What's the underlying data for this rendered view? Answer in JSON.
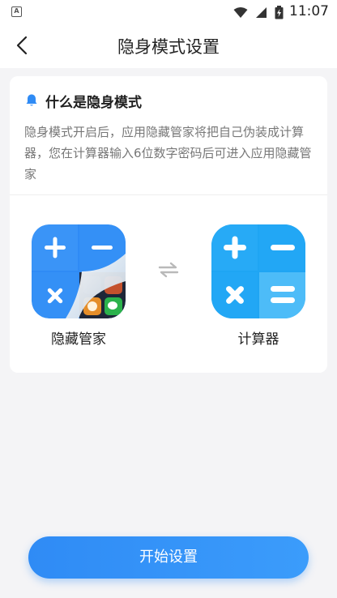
{
  "status_bar": {
    "app_badge": "A",
    "time": "11:07",
    "icons": [
      "wifi-icon",
      "signal-icon",
      "battery-charging-icon"
    ]
  },
  "nav": {
    "title": "隐身模式设置",
    "back_icon": "chevron-left-icon"
  },
  "info": {
    "title": "什么是隐身模式",
    "description": "隐身模式开启后，应用隐藏管家将把自己伪装成计算器，您在计算器输入6位数字密码后可进入应用隐藏管家",
    "icon": "bell-icon"
  },
  "apps": {
    "from_label": "隐藏管家",
    "to_label": "计算器",
    "swap_icon": "swap-arrows-icon"
  },
  "action": {
    "start_label": "开始设置"
  },
  "colors": {
    "accent": "#2f8bf5",
    "calc_tile": "#2aa9f5",
    "background": "#f4f4f6"
  }
}
